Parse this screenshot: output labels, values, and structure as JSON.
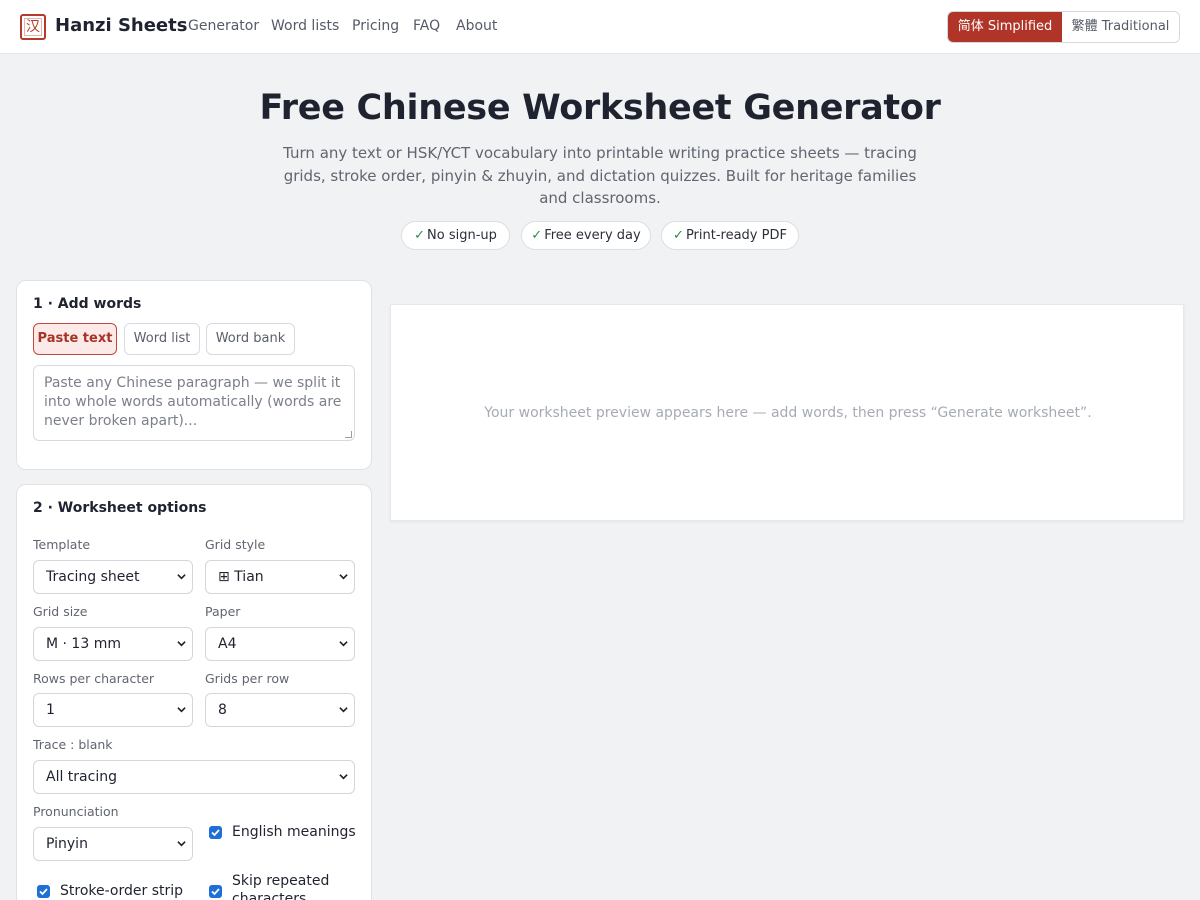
{
  "header": {
    "logo_glyph": "汉",
    "brand": "Hanzi Sheets",
    "nav": [
      "Generator",
      "Word lists",
      "Pricing",
      "FAQ",
      "About"
    ],
    "lang_simplified": "简体 Simplified",
    "lang_traditional": "繁體 Traditional"
  },
  "hero": {
    "title": "Free Chinese Worksheet Generator",
    "subtitle": "Turn any text or HSK/YCT vocabulary into printable writing practice sheets — tracing grids, stroke order, pinyin & zhuyin, and dictation quizzes. Built for heritage families and classrooms.",
    "badges": [
      "No sign-up",
      "Free every day",
      "Print-ready PDF"
    ],
    "check_glyph": "✓"
  },
  "add_words": {
    "title": "1 · Add words",
    "tabs": [
      "Paste text",
      "Word list",
      "Word bank"
    ],
    "active_tab": "Paste text",
    "textarea_placeholder": "Paste any Chinese paragraph — we split it into whole words automatically (words are never broken apart)..."
  },
  "options": {
    "title": "2 · Worksheet options",
    "template_label": "Template",
    "template_value": "Tracing sheet",
    "grid_style_label": "Grid style",
    "grid_style_value": "⊞ Tian",
    "grid_size_label": "Grid size",
    "grid_size_value": "M · 13 mm",
    "paper_label": "Paper",
    "paper_value": "A4",
    "rows_label": "Rows per character",
    "rows_value": "1",
    "grids_label": "Grids per row",
    "grids_value": "8",
    "trace_label": "Trace : blank",
    "trace_value": "All tracing",
    "pron_label": "Pronunciation",
    "pron_value": "Pinyin",
    "english_label": "English meanings",
    "english_checked": true,
    "stroke_label": "Stroke-order strip",
    "stroke_checked": true,
    "skip_label": "Skip repeated characters",
    "skip_checked": true
  },
  "preview": {
    "placeholder": "Your worksheet preview appears here — add words, then press “Generate worksheet”."
  },
  "colors": {
    "accent": "#b03427",
    "checkbox": "#1f6fd6",
    "background": "#f1f2f4"
  }
}
